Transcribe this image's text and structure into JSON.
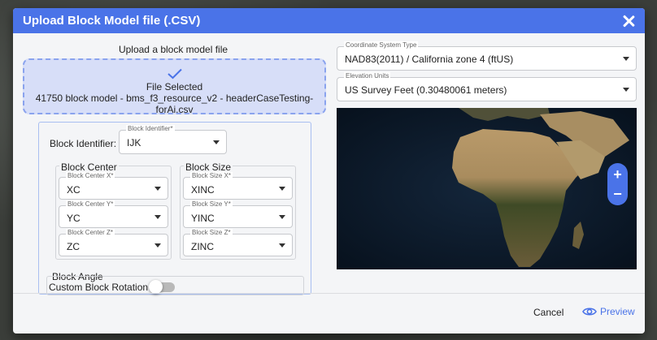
{
  "dialog": {
    "title": "Upload Block Model file (.CSV)"
  },
  "upload": {
    "label": "Upload a block model file",
    "status": "File Selected",
    "filename": "41750 block model - bms_f3_resource_v2 - headerCaseTesting-forAi.csv"
  },
  "block_identifier": {
    "label": "Block Identifier:",
    "field_label": "Block Identifier*",
    "value": "IJK"
  },
  "block_center": {
    "title": "Block Center",
    "x": {
      "label": "Block Center X*",
      "value": "XC"
    },
    "y": {
      "label": "Block Center Y*",
      "value": "YC"
    },
    "z": {
      "label": "Block Center Z*",
      "value": "ZC"
    }
  },
  "block_size": {
    "title": "Block Size",
    "x": {
      "label": "Block Size X*",
      "value": "XINC"
    },
    "y": {
      "label": "Block Size Y*",
      "value": "YINC"
    },
    "z": {
      "label": "Block Size Z*",
      "value": "ZINC"
    }
  },
  "block_angle": {
    "title": "Block Angle",
    "toggle_label": "Custom Block Rotation",
    "enabled": false
  },
  "coordinate_system": {
    "label": "Coordinate System Type",
    "value": "NAD83(2011) / California zone 4 (ftUS)"
  },
  "elevation_units": {
    "label": "Elevation Units",
    "value": "US Survey Feet (0.30480061 meters)"
  },
  "map": {
    "zoom_in": "+",
    "zoom_out": "−"
  },
  "footer": {
    "cancel": "Cancel",
    "preview": "Preview"
  },
  "colors": {
    "accent": "#4a73e8",
    "dropzone_bg": "#d7def8",
    "dropzone_border": "#8aa3ee"
  },
  "icons": {
    "close": "close-icon",
    "check": "check-icon",
    "preview": "eye-icon",
    "dropdown": "chevron-down-icon"
  }
}
